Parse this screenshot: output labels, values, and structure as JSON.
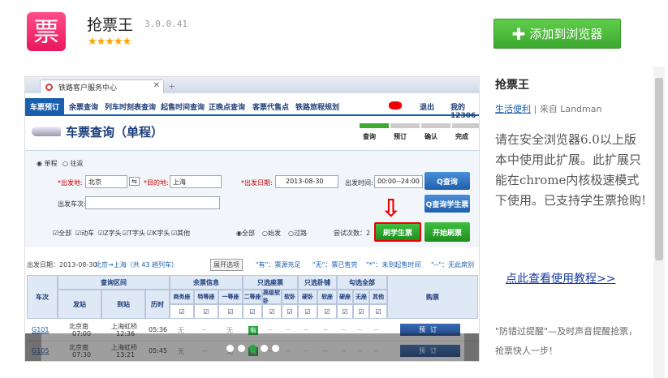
{
  "header": {
    "logo_glyph": "票",
    "title": "抢票王",
    "version": "3.0.0.41",
    "stars": "★★★★★",
    "add_button": "添加到浏览器",
    "add_plus": "✚"
  },
  "screenshot": {
    "tab_title": "铁路客户服务中心",
    "tab_close": "✕",
    "new_tab": "+",
    "nav": [
      "车票预订",
      "余票查询",
      "列车时刻表查询",
      "起售时间查询",
      "正晚点查询",
      "客票代售点",
      "铁路旅程规划",
      "退出",
      "我的12306"
    ],
    "query_title": "车票查询（单程）",
    "steps": [
      "查询",
      "预订",
      "确认",
      "完成"
    ],
    "trip_options": [
      "单程",
      "往返"
    ],
    "from_label": "*出发地:",
    "from_value": "北京",
    "to_label": "*目的地:",
    "to_value": "上海",
    "date_label": "*出发日期:",
    "date_value": "2013-08-30",
    "time_label": "出发时间:",
    "time_value": "00:00--24:00",
    "train_label": "出发车次:",
    "search_btn": "Q查询",
    "student_search_btn": "Q查询学生票",
    "types": [
      "全部",
      "动车",
      "Z字头",
      "T字头",
      "K字头",
      "其他"
    ],
    "radio_filters": [
      "全部",
      "始发",
      "过路"
    ],
    "attempts": "尝试次数：2",
    "student_buy_btn": "刷学生票",
    "start_btn": "开始刷票",
    "info_date": "出发日期：2013-08-30",
    "info_route": "北京→上海（共 43 趟列车）",
    "expand_btn": "展开选项",
    "legend": [
      "\"有\"：票源充足",
      "\"无\"：票已售完",
      "\"*\"：未到起售时间",
      "\"--\"：无此席别"
    ],
    "th": {
      "train": "车次",
      "range": "查询区间",
      "from": "发站",
      "to": "到站",
      "duration": "历时",
      "remain": "余票信息",
      "seat_only": "只选座票",
      "berth_only": "只选卧铺",
      "check_all": "勾选全部",
      "buy": "购票"
    },
    "seat_cols": [
      "商务座",
      "特等座",
      "一等座",
      "二等座",
      "高级软卧",
      "软卧",
      "硬卧",
      "软座",
      "硬座",
      "无座",
      "其他"
    ],
    "rows": [
      {
        "train": "G101",
        "from": "北京南",
        "from_time": "07:00",
        "to": "上海虹桥",
        "to_time": "12:36",
        "duration": "05:36",
        "cells": [
          "无",
          "--",
          "无",
          "有",
          "--",
          "--",
          "--",
          "--",
          "--",
          "--",
          "--"
        ],
        "book": "预订"
      },
      {
        "train": "G105",
        "from": "北京南",
        "from_time": "07:30",
        "to": "上海虹桥",
        "to_time": "13:21",
        "duration": "05:45",
        "cells": [
          "无",
          "--",
          "无",
          "有",
          "--",
          "--",
          "--",
          "--",
          "--",
          "--",
          "--"
        ],
        "book": "预订"
      }
    ]
  },
  "side": {
    "name": "抢票王",
    "category": "生活便利",
    "source": "| 来自 Landman",
    "description": "请在安全浏览器6.0以上版本中使用此扩展。此扩展只能在chrome内核极速模式下使用。已支持学生票抢购!",
    "tutorial": "点此查看使用教程>>",
    "note": "\"防错过提醒\"—及时声音提醒抢票，抢票快人一步！"
  },
  "colors": {
    "green": "#3ea830",
    "blue": "#1a5fae",
    "pink": "#e8175d"
  }
}
